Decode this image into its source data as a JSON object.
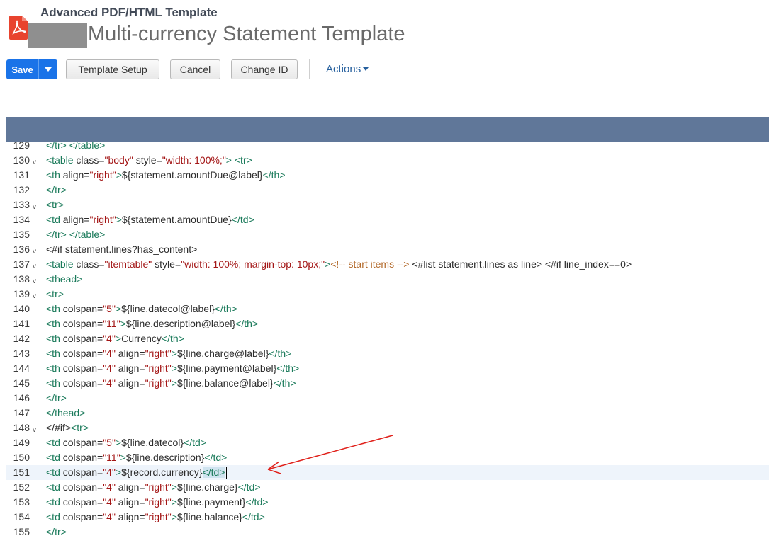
{
  "header": {
    "subtitle": "Advanced PDF/HTML Template",
    "title": "Multi-currency Statement Template"
  },
  "toolbar": {
    "save_label": "Save",
    "template_setup_label": "Template Setup",
    "cancel_label": "Cancel",
    "change_id_label": "Change ID",
    "actions_label": "Actions"
  },
  "colors": {
    "accent": "#1a73e8",
    "editor_bar": "#607799",
    "annotation_arrow": "#e0201a"
  },
  "icons": {
    "file_type": "pdf-icon",
    "save_dropdown": "caret-down-icon",
    "actions_dropdown": "caret-down-icon",
    "fold": "fold-arrow-icon"
  },
  "editor": {
    "active_line": "151",
    "lines": [
      {
        "num": "129",
        "fold": false,
        "tokens": [
          [
            "t",
            "</tr>"
          ],
          [
            "p",
            " "
          ],
          [
            "t",
            "</table>"
          ]
        ]
      },
      {
        "num": "130",
        "fold": true,
        "tokens": [
          [
            "t",
            "<table"
          ],
          [
            "p",
            " class="
          ],
          [
            "s",
            "\"body\""
          ],
          [
            "p",
            " style="
          ],
          [
            "s",
            "\"width: 100%;\""
          ],
          [
            "t",
            ">"
          ],
          [
            "p",
            " "
          ],
          [
            "t",
            "<tr>"
          ]
        ]
      },
      {
        "num": "131",
        "fold": false,
        "tokens": [
          [
            "t",
            "<th"
          ],
          [
            "p",
            " align="
          ],
          [
            "s",
            "\"right\""
          ],
          [
            "t",
            ">"
          ],
          [
            "p",
            "${statement.amountDue@label}"
          ],
          [
            "t",
            "</th>"
          ]
        ]
      },
      {
        "num": "132",
        "fold": false,
        "tokens": [
          [
            "t",
            "</tr>"
          ]
        ]
      },
      {
        "num": "133",
        "fold": true,
        "tokens": [
          [
            "t",
            "<tr>"
          ]
        ]
      },
      {
        "num": "134",
        "fold": false,
        "tokens": [
          [
            "t",
            "<td"
          ],
          [
            "p",
            " align="
          ],
          [
            "s",
            "\"right\""
          ],
          [
            "t",
            ">"
          ],
          [
            "p",
            "${statement.amountDue}"
          ],
          [
            "t",
            "</td>"
          ]
        ]
      },
      {
        "num": "135",
        "fold": false,
        "tokens": [
          [
            "t",
            "</tr>"
          ],
          [
            "p",
            " "
          ],
          [
            "t",
            "</table>"
          ]
        ]
      },
      {
        "num": "136",
        "fold": true,
        "tokens": [
          [
            "p",
            "<#if statement.lines?has_content>"
          ]
        ]
      },
      {
        "num": "137",
        "fold": true,
        "tokens": [
          [
            "t",
            "<table"
          ],
          [
            "p",
            " class="
          ],
          [
            "s",
            "\"itemtable\""
          ],
          [
            "p",
            " style="
          ],
          [
            "s",
            "\"width: 100%; margin-top: 10px;\""
          ],
          [
            "t",
            ">"
          ],
          [
            "c",
            "<!-- start items -->"
          ],
          [
            "p",
            " <#list statement.lines as line> <#if line_index==0>"
          ]
        ]
      },
      {
        "num": "138",
        "fold": true,
        "tokens": [
          [
            "t",
            "<thead>"
          ]
        ]
      },
      {
        "num": "139",
        "fold": true,
        "tokens": [
          [
            "t",
            "<tr>"
          ]
        ]
      },
      {
        "num": "140",
        "fold": false,
        "tokens": [
          [
            "t",
            "<th"
          ],
          [
            "p",
            " colspan="
          ],
          [
            "s",
            "\"5\""
          ],
          [
            "t",
            ">"
          ],
          [
            "p",
            "${line.datecol@label}"
          ],
          [
            "t",
            "</th>"
          ]
        ]
      },
      {
        "num": "141",
        "fold": false,
        "tokens": [
          [
            "t",
            "<th"
          ],
          [
            "p",
            " colspan="
          ],
          [
            "s",
            "\"11\""
          ],
          [
            "t",
            ">"
          ],
          [
            "p",
            "${line.description@label}"
          ],
          [
            "t",
            "</th>"
          ]
        ]
      },
      {
        "num": "142",
        "fold": false,
        "tokens": [
          [
            "t",
            "<th"
          ],
          [
            "p",
            " colspan="
          ],
          [
            "s",
            "\"4\""
          ],
          [
            "t",
            ">"
          ],
          [
            "p",
            "Currency"
          ],
          [
            "t",
            "</th>"
          ]
        ]
      },
      {
        "num": "143",
        "fold": false,
        "tokens": [
          [
            "t",
            "<th"
          ],
          [
            "p",
            " colspan="
          ],
          [
            "s",
            "\"4\""
          ],
          [
            "p",
            " align="
          ],
          [
            "s",
            "\"right\""
          ],
          [
            "t",
            ">"
          ],
          [
            "p",
            "${line.charge@label}"
          ],
          [
            "t",
            "</th>"
          ]
        ]
      },
      {
        "num": "144",
        "fold": false,
        "tokens": [
          [
            "t",
            "<th"
          ],
          [
            "p",
            " colspan="
          ],
          [
            "s",
            "\"4\""
          ],
          [
            "p",
            " align="
          ],
          [
            "s",
            "\"right\""
          ],
          [
            "t",
            ">"
          ],
          [
            "p",
            "${line.payment@label}"
          ],
          [
            "t",
            "</th>"
          ]
        ]
      },
      {
        "num": "145",
        "fold": false,
        "tokens": [
          [
            "t",
            "<th"
          ],
          [
            "p",
            " colspan="
          ],
          [
            "s",
            "\"4\""
          ],
          [
            "p",
            " align="
          ],
          [
            "s",
            "\"right\""
          ],
          [
            "t",
            ">"
          ],
          [
            "p",
            "${line.balance@label}"
          ],
          [
            "t",
            "</th>"
          ]
        ]
      },
      {
        "num": "146",
        "fold": false,
        "tokens": [
          [
            "t",
            "</tr>"
          ]
        ]
      },
      {
        "num": "147",
        "fold": false,
        "tokens": [
          [
            "t",
            "</thead>"
          ]
        ]
      },
      {
        "num": "148",
        "fold": true,
        "tokens": [
          [
            "p",
            "</#if>"
          ],
          [
            "t",
            "<tr>"
          ]
        ]
      },
      {
        "num": "149",
        "fold": false,
        "tokens": [
          [
            "t",
            "<td"
          ],
          [
            "p",
            " colspan="
          ],
          [
            "s",
            "\"5\""
          ],
          [
            "t",
            ">"
          ],
          [
            "p",
            "${line.datecol}"
          ],
          [
            "t",
            "</td>"
          ]
        ]
      },
      {
        "num": "150",
        "fold": false,
        "tokens": [
          [
            "t",
            "<td"
          ],
          [
            "p",
            " colspan="
          ],
          [
            "s",
            "\"11\""
          ],
          [
            "t",
            ">"
          ],
          [
            "p",
            "${line.description}"
          ],
          [
            "t",
            "</td>"
          ]
        ]
      },
      {
        "num": "151",
        "fold": false,
        "tokens": [
          [
            "t",
            "<td"
          ],
          [
            "p",
            " colspan="
          ],
          [
            "s",
            "\"4\""
          ],
          [
            "t",
            ">"
          ],
          [
            "p",
            "${record.currency}"
          ],
          [
            "h",
            "</td>"
          ]
        ]
      },
      {
        "num": "152",
        "fold": false,
        "tokens": [
          [
            "t",
            "<td"
          ],
          [
            "p",
            " colspan="
          ],
          [
            "s",
            "\"4\""
          ],
          [
            "p",
            " align="
          ],
          [
            "s",
            "\"right\""
          ],
          [
            "t",
            ">"
          ],
          [
            "p",
            "${line.charge}"
          ],
          [
            "t",
            "</td>"
          ]
        ]
      },
      {
        "num": "153",
        "fold": false,
        "tokens": [
          [
            "t",
            "<td"
          ],
          [
            "p",
            " colspan="
          ],
          [
            "s",
            "\"4\""
          ],
          [
            "p",
            " align="
          ],
          [
            "s",
            "\"right\""
          ],
          [
            "t",
            ">"
          ],
          [
            "p",
            "${line.payment}"
          ],
          [
            "t",
            "</td>"
          ]
        ]
      },
      {
        "num": "154",
        "fold": false,
        "tokens": [
          [
            "t",
            "<td"
          ],
          [
            "p",
            " colspan="
          ],
          [
            "s",
            "\"4\""
          ],
          [
            "p",
            " align="
          ],
          [
            "s",
            "\"right\""
          ],
          [
            "t",
            ">"
          ],
          [
            "p",
            "${line.balance}"
          ],
          [
            "t",
            "</td>"
          ]
        ]
      },
      {
        "num": "155",
        "fold": false,
        "tokens": [
          [
            "t",
            "</tr>"
          ]
        ]
      }
    ]
  }
}
